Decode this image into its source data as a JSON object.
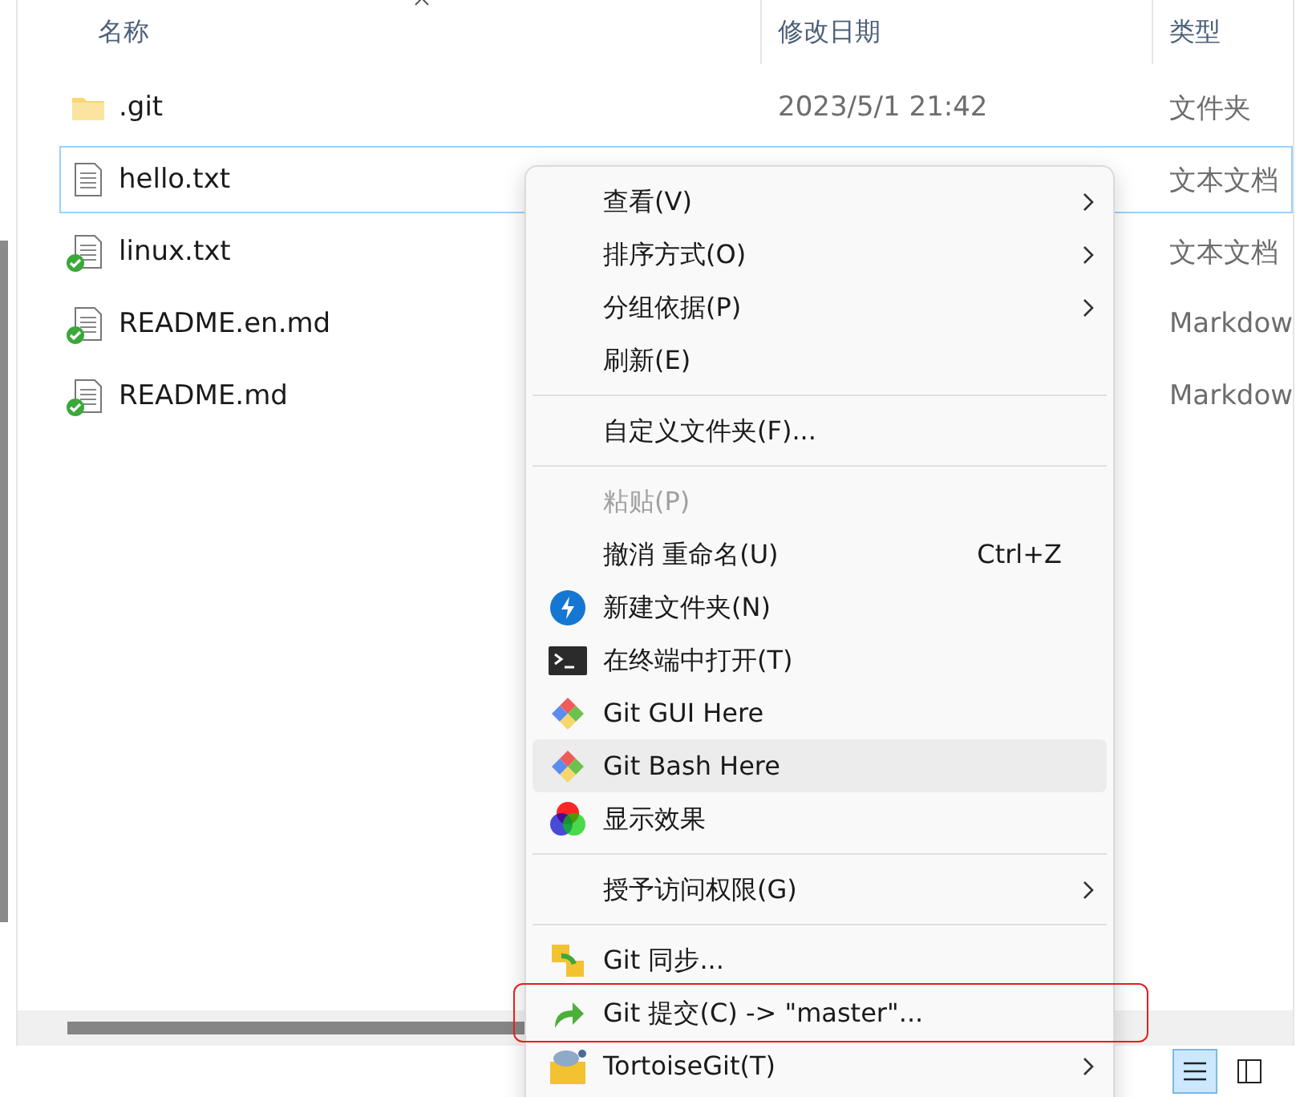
{
  "columns": [
    "名称",
    "修改日期",
    "类型"
  ],
  "files": [
    {
      "name": ".git",
      "kind": "folder",
      "date": "2023/5/1 21:42",
      "type": "文件夹",
      "selected": false,
      "synced": false
    },
    {
      "name": "hello.txt",
      "kind": "text",
      "type": "文本文档",
      "selected": true,
      "synced": false
    },
    {
      "name": "linux.txt",
      "kind": "text",
      "type": "文本文档",
      "selected": false,
      "synced": true
    },
    {
      "name": "README.en.md",
      "kind": "text",
      "type": "Markdow",
      "selected": false,
      "synced": true
    },
    {
      "name": "README.md",
      "kind": "text",
      "type": "Markdow",
      "selected": false,
      "synced": true
    }
  ],
  "context_menu": [
    {
      "kind": "item",
      "label": "查看(V)",
      "submenu": true,
      "disabled": false,
      "hovered": false,
      "highlighted": false
    },
    {
      "kind": "item",
      "label": "排序方式(O)",
      "submenu": true,
      "disabled": false,
      "hovered": false,
      "highlighted": false
    },
    {
      "kind": "item",
      "label": "分组依据(P)",
      "submenu": true,
      "disabled": false,
      "hovered": false,
      "highlighted": false
    },
    {
      "kind": "item",
      "label": "刷新(E)",
      "submenu": false,
      "disabled": false,
      "hovered": false,
      "highlighted": false
    },
    {
      "kind": "separator"
    },
    {
      "kind": "item",
      "label": "自定义文件夹(F)...",
      "submenu": false,
      "disabled": false,
      "hovered": false,
      "highlighted": false
    },
    {
      "kind": "separator"
    },
    {
      "kind": "item",
      "label": "粘贴(P)",
      "submenu": false,
      "disabled": true,
      "hovered": false,
      "highlighted": false
    },
    {
      "kind": "item",
      "label": "撤消 重命名(U)",
      "shortcut": "Ctrl+Z",
      "submenu": false,
      "disabled": false,
      "hovered": false,
      "highlighted": false
    },
    {
      "kind": "item",
      "label": "新建文件夹(N)",
      "submenu": false,
      "disabled": false,
      "hovered": false,
      "highlighted": false
    },
    {
      "kind": "item",
      "label": "在终端中打开(T)",
      "submenu": false,
      "disabled": false,
      "hovered": false,
      "highlighted": false
    },
    {
      "kind": "item",
      "label": "Git GUI Here",
      "submenu": false,
      "disabled": false,
      "hovered": false,
      "highlighted": false
    },
    {
      "kind": "item",
      "label": "Git Bash Here",
      "submenu": false,
      "disabled": false,
      "hovered": true,
      "highlighted": false
    },
    {
      "kind": "item",
      "label": "显示效果",
      "submenu": false,
      "disabled": false,
      "hovered": false,
      "highlighted": false
    },
    {
      "kind": "separator"
    },
    {
      "kind": "item",
      "label": "授予访问权限(G)",
      "submenu": true,
      "disabled": false,
      "hovered": false,
      "highlighted": false
    },
    {
      "kind": "separator"
    },
    {
      "kind": "item",
      "label": "Git 同步...",
      "submenu": false,
      "disabled": false,
      "hovered": false,
      "highlighted": false
    },
    {
      "kind": "item",
      "label": "Git 提交(C) -> \"master\"...",
      "submenu": false,
      "disabled": false,
      "hovered": false,
      "highlighted": true
    },
    {
      "kind": "item",
      "label": "TortoiseGit(T)",
      "submenu": true,
      "disabled": false,
      "hovered": false,
      "highlighted": false
    }
  ]
}
